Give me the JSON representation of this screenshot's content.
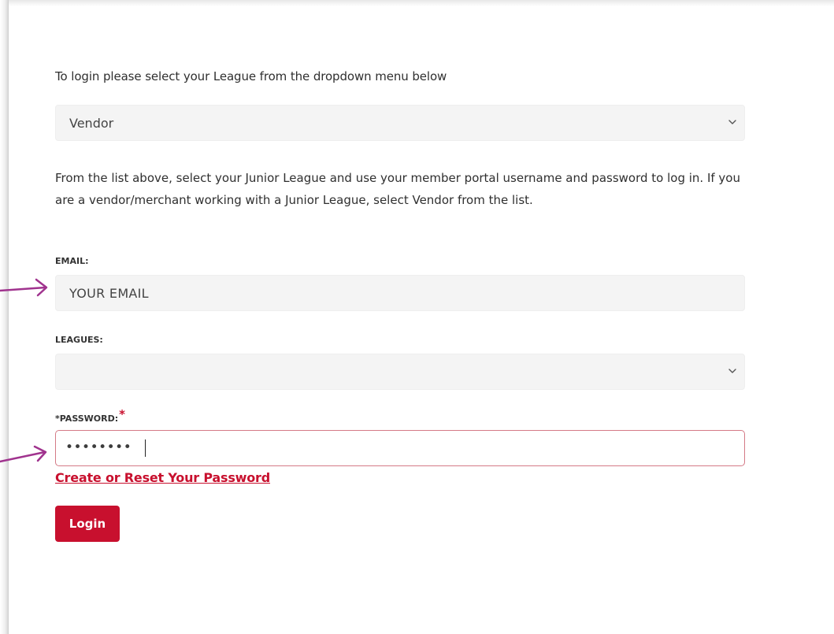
{
  "intro_text": "To login please select your League from the dropdown menu below",
  "league_select": {
    "selected": "Vendor"
  },
  "description": "From the list above, select your Junior League and use your member portal username and password to log in. If you are a vendor/merchant working with a Junior League, select Vendor from the list.",
  "email": {
    "label": "EMAIL:",
    "value": "YOUR EMAIL"
  },
  "leagues": {
    "label": "LEAGUES:",
    "selected": ""
  },
  "password": {
    "label": "*PASSWORD:",
    "required_marker": "*",
    "value": "••••••••"
  },
  "reset_link": "Create or Reset Your Password",
  "login_button": "Login",
  "colors": {
    "accent": "#c8102e",
    "annotation_arrow": "#a0338e",
    "input_background": "#f4f4f4",
    "password_border": "#d47a86"
  },
  "icons": {
    "dropdown": "chevron-down-icon",
    "annotation": "arrow-right-icon"
  }
}
